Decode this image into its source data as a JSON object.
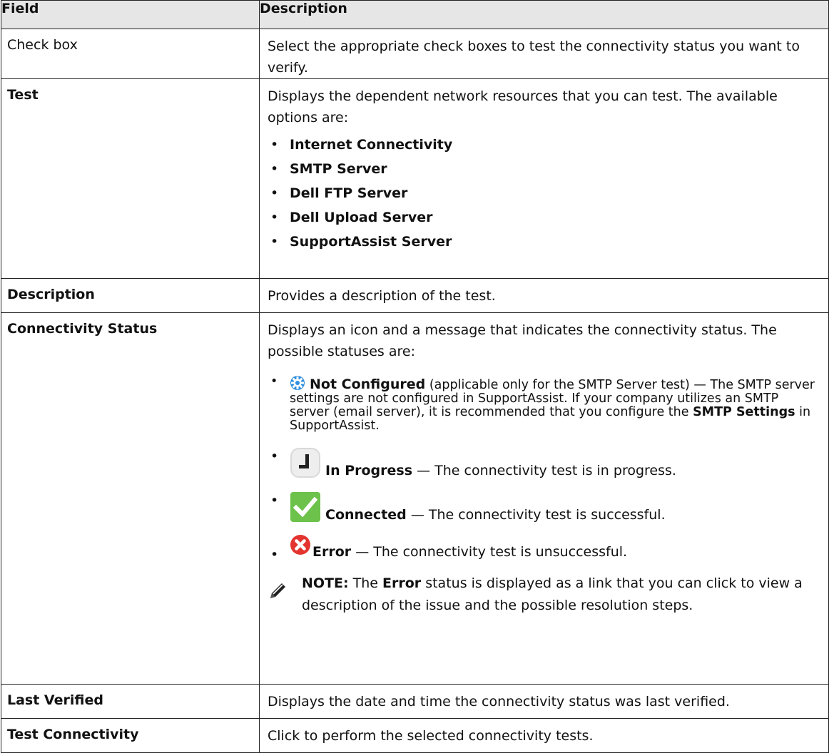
{
  "table": {
    "headers": [
      "Field",
      "Description"
    ],
    "rows": {
      "checkbox": {
        "field": "Check box",
        "desc": "Select the appropriate check boxes to test the connectivity status you want to verify."
      },
      "test": {
        "field": "Test",
        "desc": "Displays the dependent network resources that you can test. The available options are:",
        "options": [
          "Internet Connectivity",
          "SMTP Server",
          "Dell FTP Server",
          "Dell Upload Server",
          "SupportAssist Server"
        ]
      },
      "description": {
        "field": "Description",
        "desc": "Provides a description of the test."
      },
      "connectivity": {
        "field": "Connectivity Status",
        "desc": "Displays an icon and a message that indicates the connectivity status. The possible statuses are:",
        "statuses": {
          "not_configured": {
            "label": "Not Configured",
            "text_a": " (applicable only for the SMTP Server test) — The SMTP server settings are not configured in SupportAssist. If your company utilizes an SMTP server (email server), it is recommended that you configure the ",
            "emph": "SMTP Settings",
            "text_b": " in SupportAssist.",
            "icon": "gear-icon"
          },
          "in_progress": {
            "label": "In Progress",
            "text": " — The connectivity test is in progress.",
            "icon": "clock-icon"
          },
          "connected": {
            "label": "Connected",
            "text": " — The connectivity test is successful.",
            "icon": "checkmark-icon"
          },
          "error": {
            "label": "Error",
            "text": " — The connectivity test is unsuccessful.",
            "icon": "error-icon"
          }
        },
        "note": {
          "prefix": "NOTE:",
          "text_a": " The ",
          "emph": "Error",
          "text_b": " status is displayed as a link that you can click to view a description of the issue and the possible resolution steps.",
          "icon": "pencil-note-icon"
        }
      },
      "last_verified": {
        "field": "Last Verified",
        "desc": "Displays the date and time the connectivity status was last verified."
      },
      "test_connectivity": {
        "field": "Test Connectivity",
        "desc": "Click to perform the selected connectivity tests."
      }
    }
  },
  "colors": {
    "header_bg": "#e6e6e6",
    "border": "#222222",
    "gear_blue": "#2f8fe0",
    "check_green": "#6cc24a",
    "error_red": "#e3342f"
  }
}
